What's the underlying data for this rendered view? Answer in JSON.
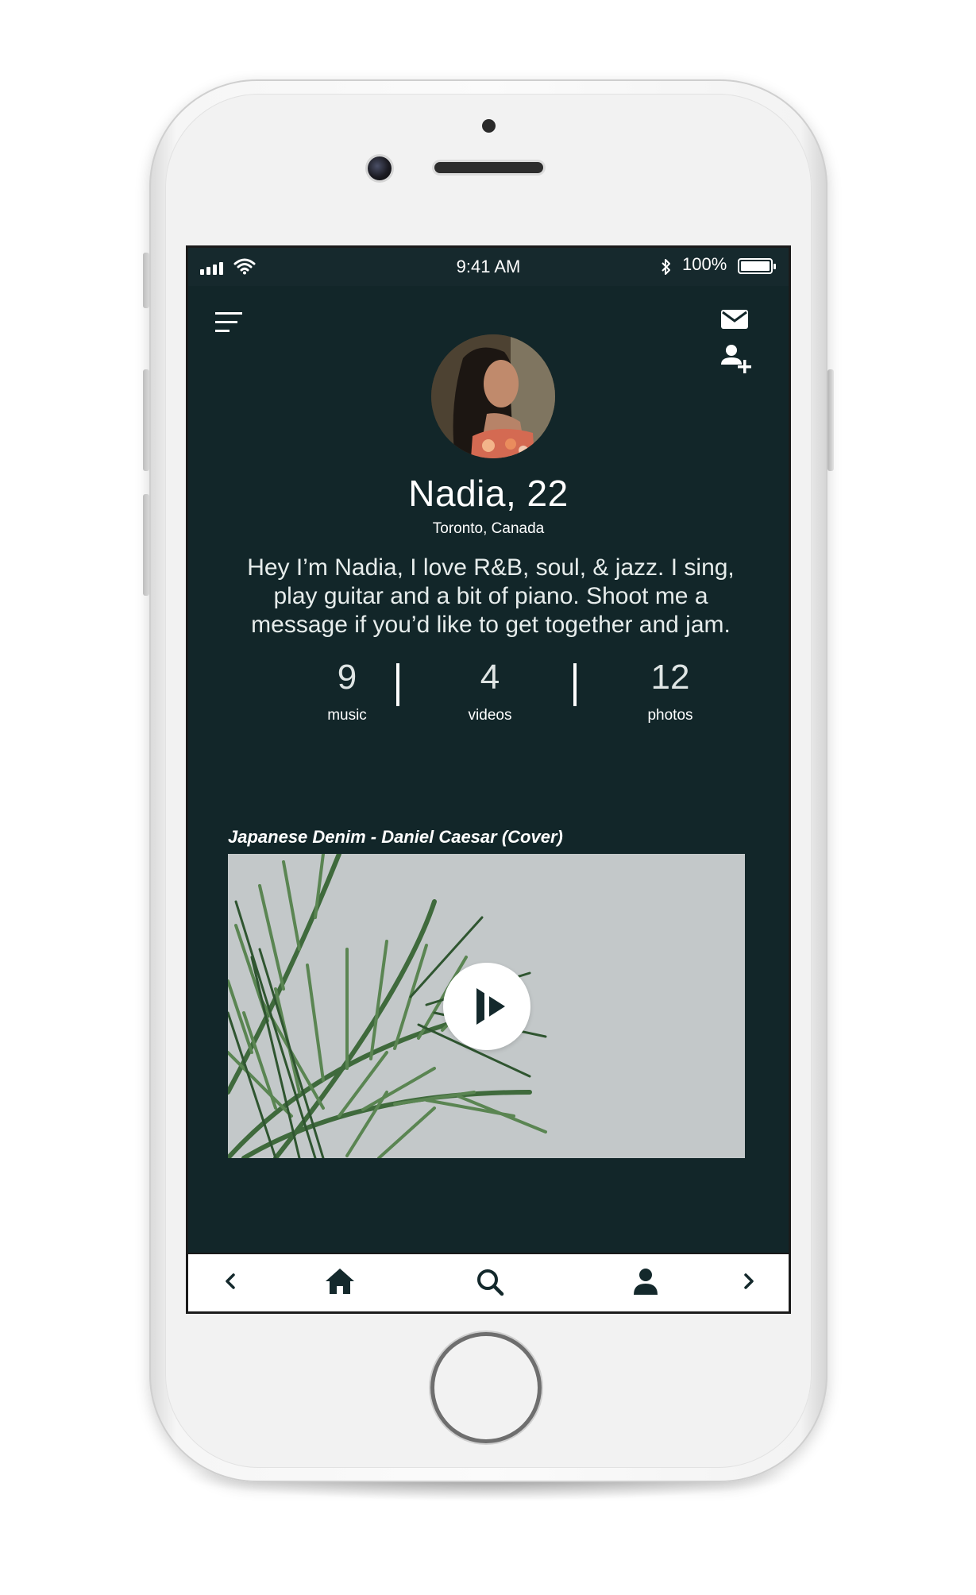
{
  "status_bar": {
    "time": "9:41 AM",
    "battery_percent": "100%",
    "icons": [
      "signal-icon",
      "wifi-icon",
      "bluetooth-icon",
      "battery-icon"
    ]
  },
  "header": {
    "menu_icon": "menu-icon",
    "message_icon": "mail-icon",
    "add_friend_icon": "add-user-icon"
  },
  "profile": {
    "name": "Nadia, 22",
    "location": "Toronto, Canada",
    "bio": "Hey I’m Nadia, I love R&B, soul, & jazz. I sing, play guitar and a bit of piano. Shoot me a message if you’d like to get together and jam."
  },
  "stats": [
    {
      "value": "9",
      "label": "music"
    },
    {
      "value": "4",
      "label": "videos"
    },
    {
      "value": "12",
      "label": "photos"
    }
  ],
  "featured": {
    "title": "Japanese Denim - Daniel Caesar (Cover)",
    "play_icon": "play-icon"
  },
  "bottom_nav": {
    "items": [
      "back-chevron-icon",
      "home-icon",
      "search-icon",
      "profile-icon",
      "forward-chevron-icon"
    ]
  },
  "colors": {
    "screen_bg": "#122629",
    "text": "#ffffff",
    "nav_bg": "#ffffff",
    "nav_icon": "#14292c"
  }
}
